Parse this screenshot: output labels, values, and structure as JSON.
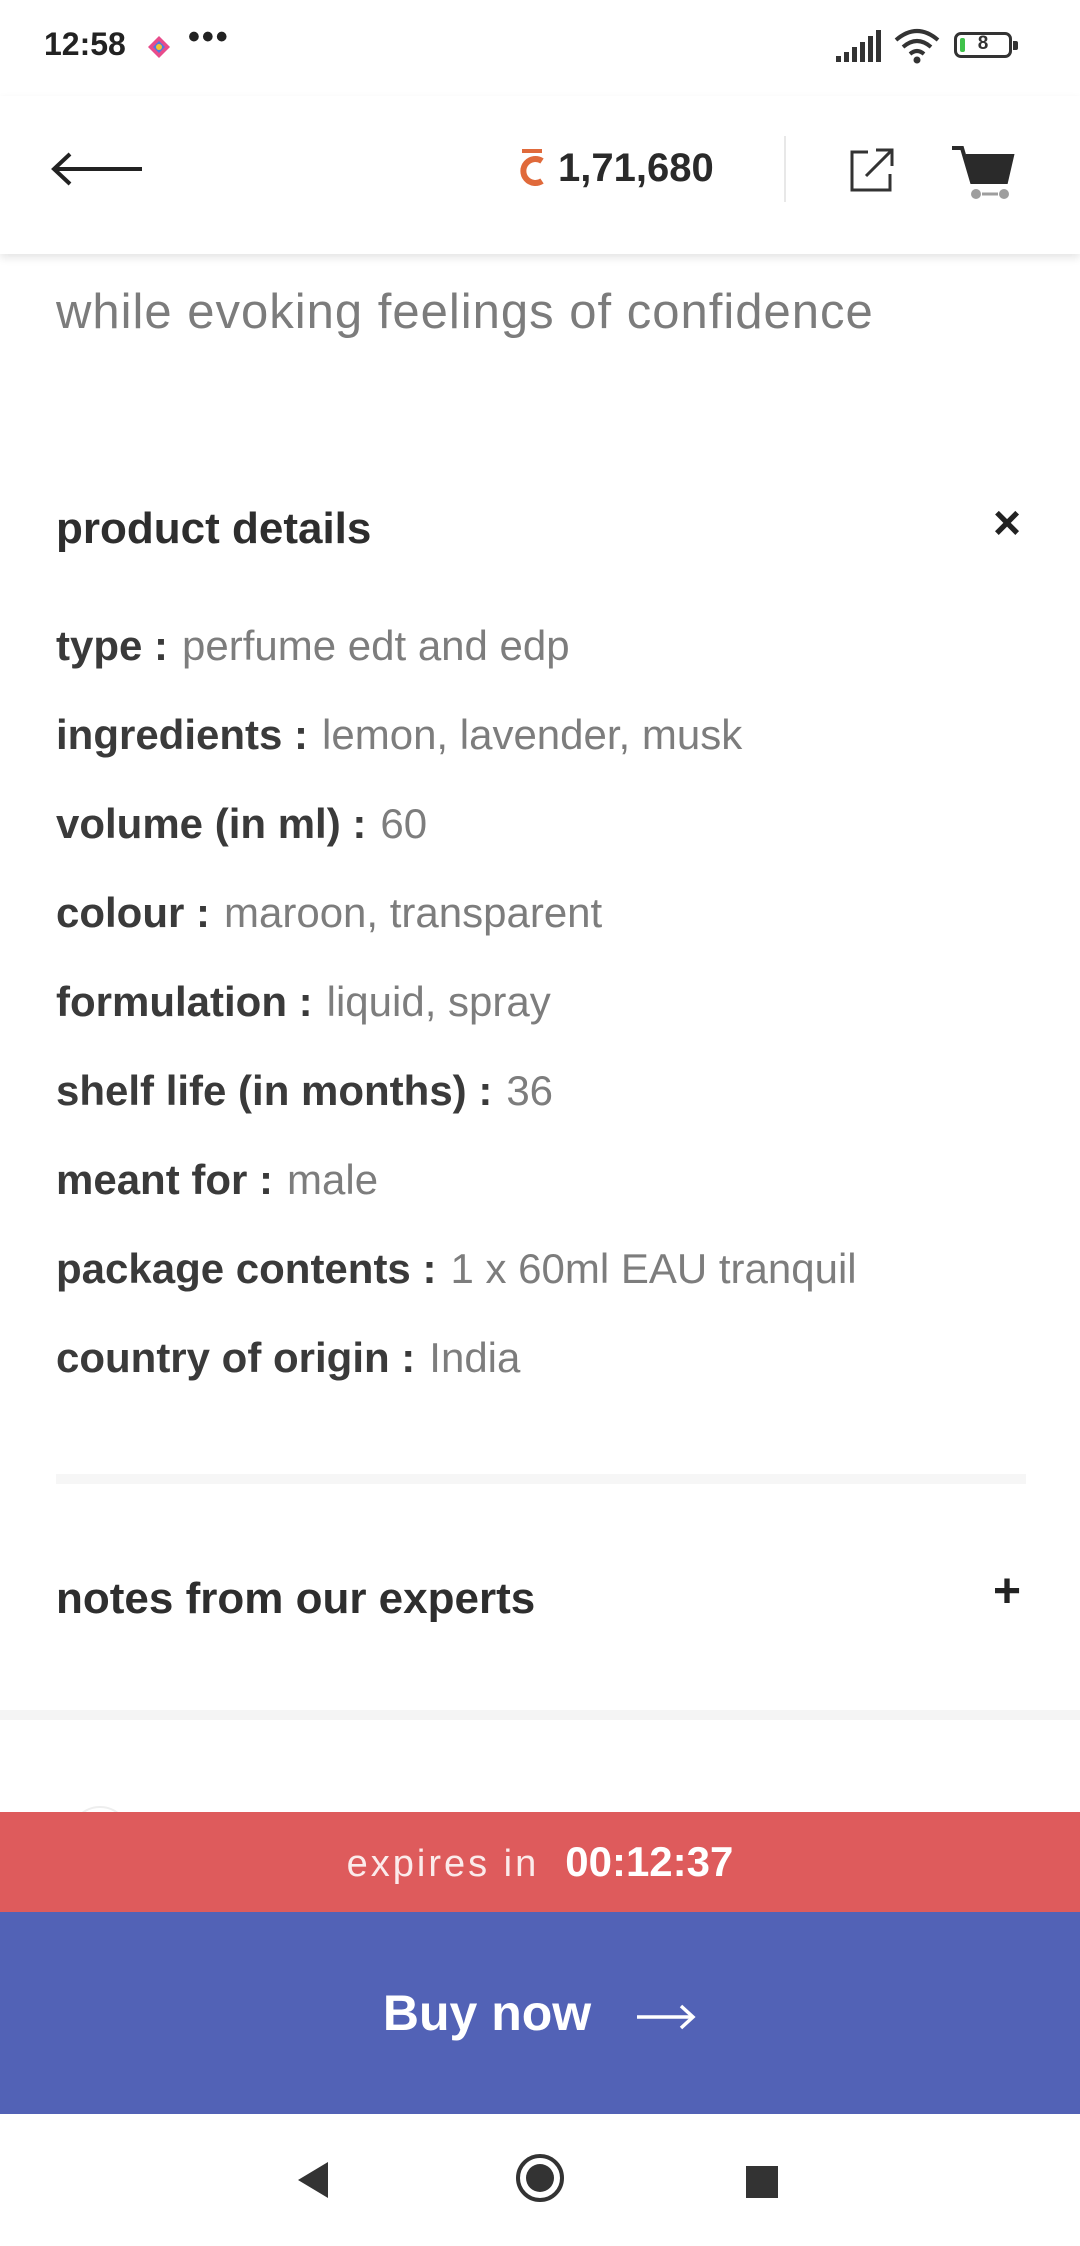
{
  "status": {
    "time": "12:58",
    "dots": "•••",
    "battery": "8"
  },
  "header": {
    "coin_symbol": "C",
    "balance": "1,71,680"
  },
  "description": {
    "text": "while evoking feelings of confidence"
  },
  "product_details": {
    "title": "product details",
    "toggle": "×",
    "rows": [
      {
        "label": "type :",
        "value": "perfume edt and edp"
      },
      {
        "label": "ingredients :",
        "value": "lemon, lavender, musk"
      },
      {
        "label": "volume (in ml) :",
        "value": "60"
      },
      {
        "label": "colour :",
        "value": "maroon, transparent"
      },
      {
        "label": "formulation :",
        "value": "liquid, spray"
      },
      {
        "label": "shelf life (in months) :",
        "value": "36"
      },
      {
        "label": "meant for :",
        "value": "male"
      },
      {
        "label": "package contents :",
        "value": "1 x 60ml EAU tranquil"
      },
      {
        "label": "country of origin :",
        "value": "India"
      }
    ]
  },
  "notes": {
    "title": "notes from our experts",
    "toggle": "+"
  },
  "expiry": {
    "label": "expires in",
    "time": "00:12:37"
  },
  "buy": {
    "label": "Buy now"
  },
  "colors": {
    "expiry_bg": "#de5b5c",
    "buy_bg": "#5262b6",
    "coin": "#e06a3b"
  }
}
